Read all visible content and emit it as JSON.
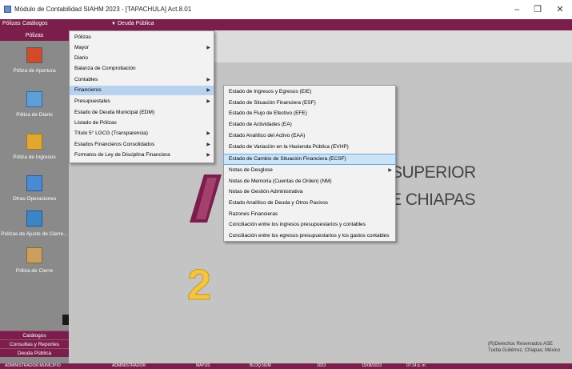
{
  "window": {
    "title": "Módulo de Contabilidad SIAHM 2023 - [TAPACHULA] Act.8.01",
    "minimize": "–",
    "maximize": "❐",
    "close": "✕"
  },
  "menubar": {
    "items": [
      "Pólizas",
      "Catálogos",
      "Deuda Pública"
    ]
  },
  "sidebar": {
    "header": "Pólizas",
    "items": [
      {
        "label": "Póliza de Apertura",
        "icon": "red-book-icon"
      },
      {
        "label": "Póliza de Diario",
        "icon": "ledger-icon"
      },
      {
        "label": "Póliza de Ingresos",
        "icon": "income-icon"
      },
      {
        "label": "Otras Operaciones",
        "icon": "transfer-icon"
      },
      {
        "label": "Pólizas de Ajuste de Cierre...",
        "icon": "adjust-icon"
      },
      {
        "label": "Póliza de Cierre",
        "icon": "lock-book-icon"
      }
    ],
    "bottom": [
      "Catálogos",
      "Consultas y Reportes",
      "Deuda Pública"
    ]
  },
  "menu_main": [
    {
      "label": "Pólizas",
      "submenu": false
    },
    {
      "label": "Mayor",
      "submenu": true
    },
    {
      "label": "Diario",
      "submenu": false
    },
    {
      "label": "Balanza de Comprobación",
      "submenu": false
    },
    {
      "label": "Contables",
      "submenu": true
    },
    {
      "label": "Financieros",
      "submenu": true
    },
    {
      "label": "Presupuestales",
      "submenu": true
    },
    {
      "label": "Estado de Deuda Municipal (EDM)",
      "submenu": false
    },
    {
      "label": "Listado de Pólizas",
      "submenu": false
    },
    {
      "label": "Título 5° LGCG (Transparencia)",
      "submenu": true
    },
    {
      "label": "Estados Financieros Consolidados",
      "submenu": true
    },
    {
      "label": "Formatos de Ley de Disciplina Financiera",
      "submenu": true
    }
  ],
  "menu_financieros": [
    {
      "label": "Estado de Ingresos y Egresos (EIE)",
      "submenu": false
    },
    {
      "label": "Estado de Situación Financiera (ESF)",
      "submenu": false
    },
    {
      "label": "Estado de Flujo de Efectivo (EFE)",
      "submenu": false
    },
    {
      "label": "Estado de Actividades (EA)",
      "submenu": false
    },
    {
      "label": "Estado Analítico del Activo (EAA)",
      "submenu": false
    },
    {
      "label": "Estado de Variación en la Hacienda Pública (EVHP)",
      "submenu": false
    },
    {
      "label": "Estado de Cambio de Situación Financiera (ECSF)",
      "submenu": false
    },
    {
      "label": "Notas de Desglose",
      "submenu": true
    },
    {
      "label": "Notas de Memoria (Cuentas de Orden) (NM)",
      "submenu": false
    },
    {
      "label": "Notas de Gestión Administrativa",
      "submenu": false
    },
    {
      "label": "Estado Analítico de Deuda y Otros Pasivos",
      "submenu": false
    },
    {
      "label": "Razones Financieras",
      "submenu": false
    },
    {
      "label": "Conciliación entre los ingresos presupuestarios y contables",
      "submenu": false
    },
    {
      "label": "Conciliación entre los egresos presupuestarios y los gastos contables",
      "submenu": false
    }
  ],
  "background": {
    "logo_line1": "SUPERIOR",
    "logo_line2": "E CHIAPAS",
    "annotation_number": "2",
    "copyright_line1": "(R)Derechos Reservados ASE",
    "copyright_line2": "Tuxtla Gutiérrez, Chiapas; México"
  },
  "status": {
    "fields": [
      "ADMINISTRADOR MUNICIPIO",
      "ADMINISTRADOR",
      "MAYUS",
      "BLOQ NUM",
      "2023",
      "15/08/2023",
      "07:14 p. m."
    ]
  },
  "colors": {
    "brand": "#7b1e4b",
    "highlight": "#cce4f7",
    "annotation": "#f5c542"
  }
}
